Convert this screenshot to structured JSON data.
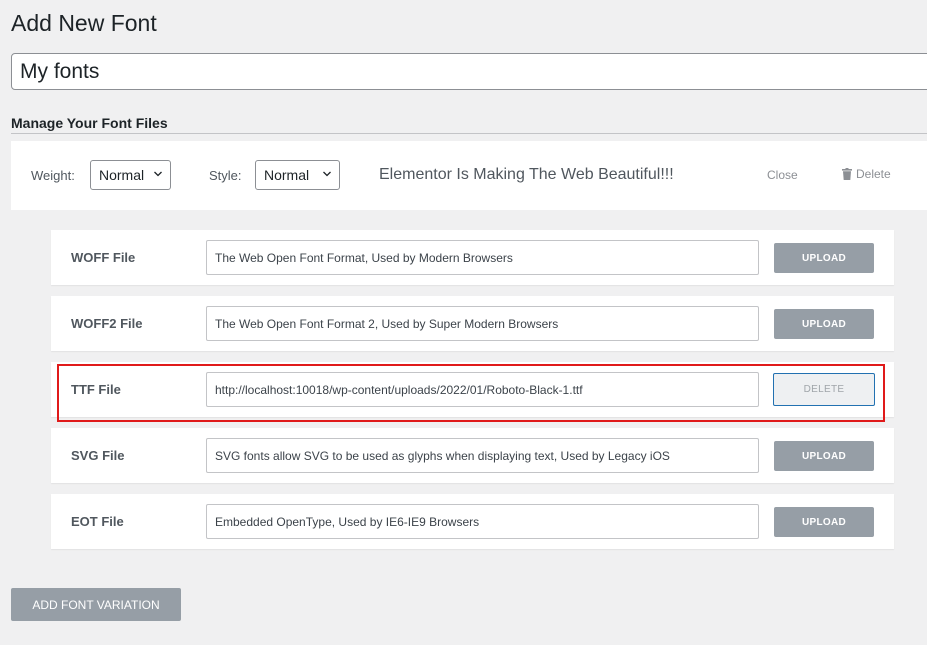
{
  "page": {
    "title": "Add New Font"
  },
  "font_title": {
    "value": "My fonts"
  },
  "section": {
    "title": "Manage Your Font Files"
  },
  "variation": {
    "weight_label": "Weight:",
    "weight_value": "Normal",
    "style_label": "Style:",
    "style_value": "Normal",
    "preview_text": "Elementor Is Making The Web Beautiful!!!",
    "close_label": "Close",
    "delete_label": "Delete"
  },
  "files": [
    {
      "label": "WOFF File",
      "value": "The Web Open Font Format, Used by Modern Browsers",
      "button": "UPLOAD"
    },
    {
      "label": "WOFF2 File",
      "value": "The Web Open Font Format 2, Used by Super Modern Browsers",
      "button": "UPLOAD"
    },
    {
      "label": "TTF File",
      "value": "http://localhost:10018/wp-content/uploads/2022/01/Roboto-Black-1.ttf",
      "button": "DELETE"
    },
    {
      "label": "SVG File",
      "value": "SVG fonts allow SVG to be used as glyphs when displaying text, Used by Legacy iOS",
      "button": "UPLOAD"
    },
    {
      "label": "EOT File",
      "value": "Embedded OpenType, Used by IE6-IE9 Browsers",
      "button": "UPLOAD"
    }
  ],
  "add_variation_label": "ADD FONT VARIATION",
  "colors": {
    "accent_blue": "#2271b1",
    "highlight_red": "#e01a1a",
    "button_gray": "#969ea6"
  }
}
